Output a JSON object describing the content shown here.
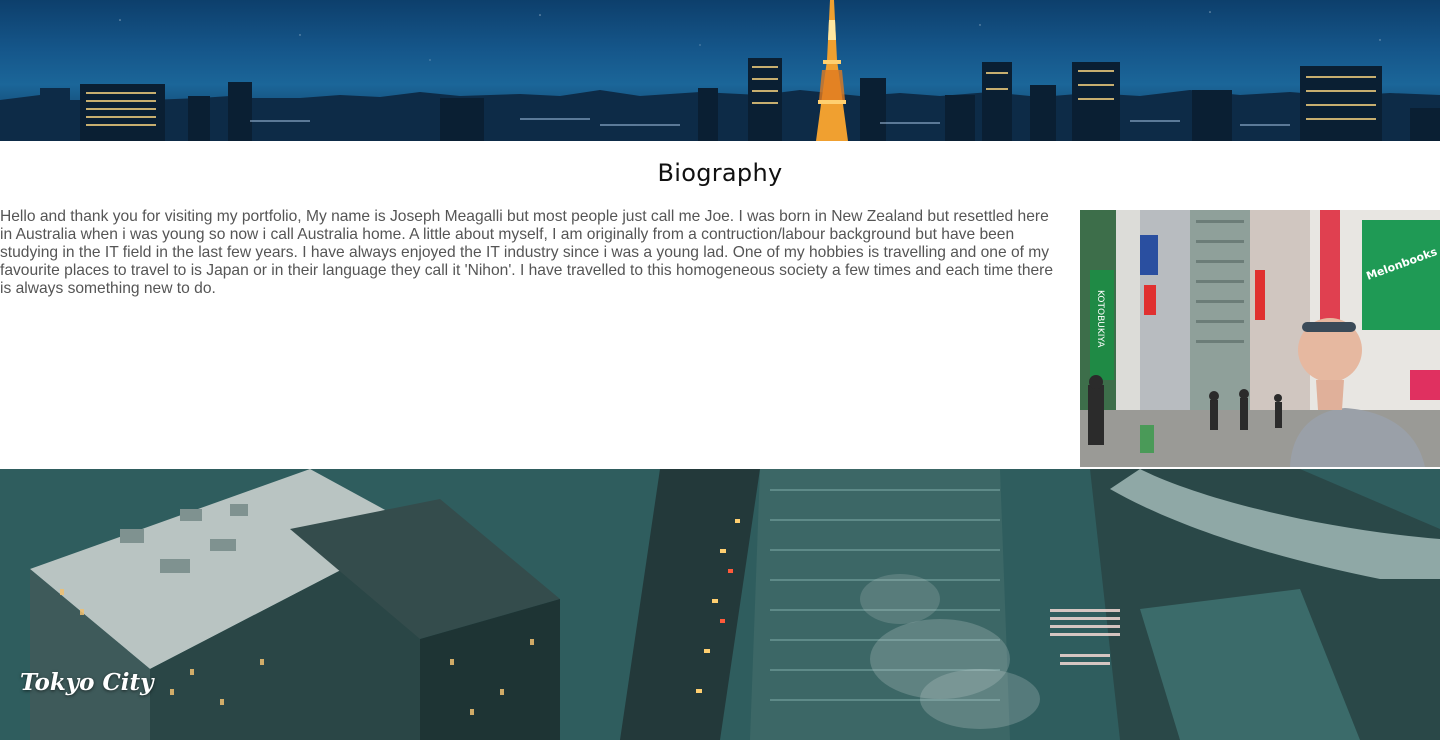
{
  "header_banner": {
    "alt": "night-city-skyline"
  },
  "biography": {
    "title": "Biography",
    "text": "Hello and thank you for visiting my portfolio, My name is Joseph Meagalli but most people just call me Joe. I was born in New Zealand but resettled here in Australia when i was young so now i call Australia home. A little about myself, I am originally from a contruction/labour background but have been studying in the IT field in the last few years. I have always enjoyed the IT industry since i was a young lad. One of my hobbies is travelling and one of my favourite places to travel to is Japan or in their language they call it 'Nihon'. I have travelled to this homogeneous society a few times and each time there is always something new to do.",
    "photo_signs": [
      "KOTOBUKIYA",
      "Melonbooks"
    ]
  },
  "footer_banner": {
    "caption": "Tokyo City"
  },
  "colors": {
    "banner_sky": "#15568a",
    "aerial_tint": "#2e5a5a",
    "body_text": "#555555"
  }
}
